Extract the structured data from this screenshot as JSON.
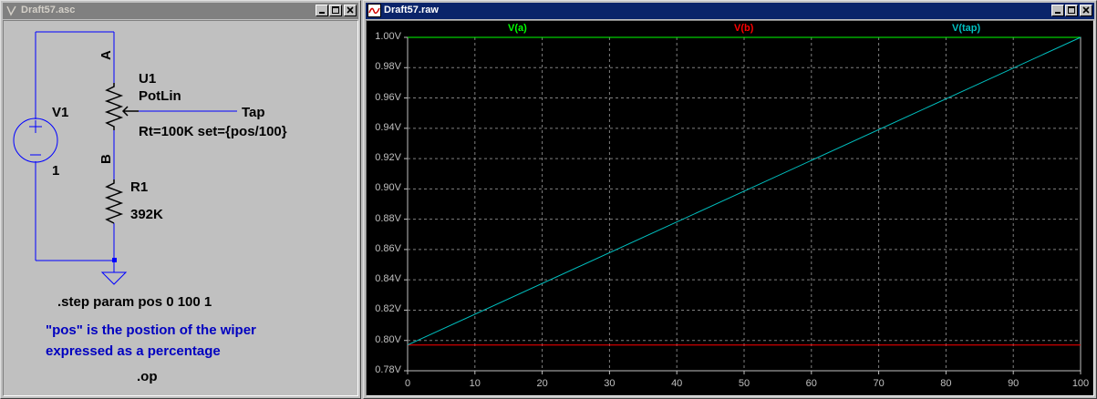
{
  "schematic_window": {
    "title": "Draft57.asc",
    "components": {
      "v1_name": "V1",
      "v1_value": "1",
      "u1_name": "U1",
      "u1_model": "PotLin",
      "pin_a": "A",
      "pin_b": "B",
      "tap_label": "Tap",
      "u1_params": "Rt=100K set={pos/100}",
      "r1_name": "R1",
      "r1_value": "392K"
    },
    "directives": {
      "step": ".step param pos 0 100 1",
      "comment_line1": "\"pos\" is the postion of the wiper",
      "comment_line2": "expressed as a percentage",
      "op": ".op"
    }
  },
  "waveform_window": {
    "title": "Draft57.raw",
    "traces": [
      {
        "name": "V(a)",
        "color": "#00ff00"
      },
      {
        "name": "V(b)",
        "color": "#ff0000"
      },
      {
        "name": "V(tap)",
        "color": "#00c0c0"
      }
    ]
  },
  "chart_data": {
    "type": "line",
    "x": [
      0,
      100
    ],
    "series": [
      {
        "name": "V(a)",
        "values": [
          1.0,
          1.0
        ],
        "color": "#00ff00"
      },
      {
        "name": "V(b)",
        "values": [
          0.797,
          0.797
        ],
        "color": "#ff0000"
      },
      {
        "name": "V(tap)",
        "values": [
          0.797,
          1.0
        ],
        "color": "#00c0c0"
      }
    ],
    "xlim": [
      0,
      100
    ],
    "ylim": [
      0.78,
      1.0
    ],
    "xticks": [
      "0",
      "10",
      "20",
      "30",
      "40",
      "50",
      "60",
      "70",
      "80",
      "90",
      "100"
    ],
    "yticks": [
      "0.78V",
      "0.80V",
      "0.82V",
      "0.84V",
      "0.86V",
      "0.88V",
      "0.90V",
      "0.92V",
      "0.94V",
      "0.96V",
      "0.98V",
      "1.00V"
    ],
    "grid": true
  }
}
